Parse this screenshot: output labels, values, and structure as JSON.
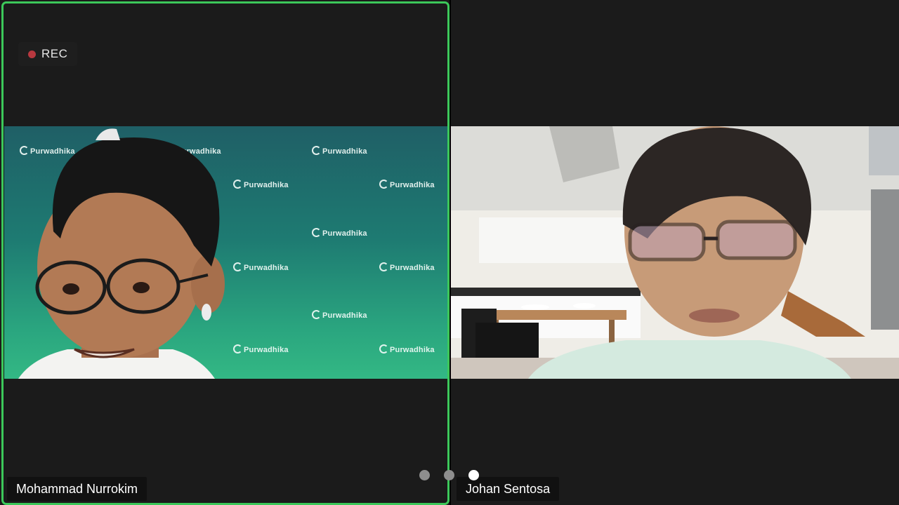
{
  "meeting": {
    "recording_label": "REC",
    "participants": [
      {
        "name": "Mohammad Nurrokim",
        "active_speaker": true
      },
      {
        "name": "Johan Sentosa",
        "active_speaker": false
      }
    ],
    "background_logo_text": "Purwadhika",
    "pages": {
      "count": 3,
      "current": 3
    }
  },
  "colors": {
    "active_speaker_border": "#3cc85a",
    "rec_dot": "#b8383f",
    "tile_background": "#1b1b1b"
  }
}
